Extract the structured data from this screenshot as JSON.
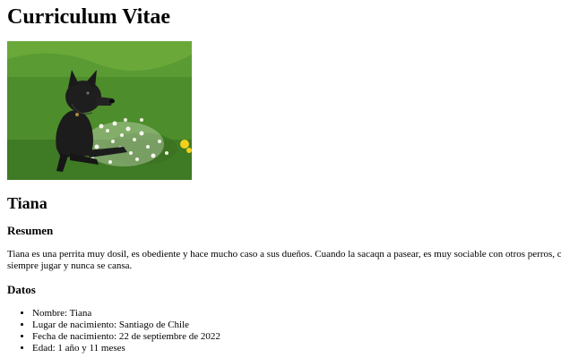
{
  "page": {
    "title": "Curriculum Vitae",
    "name": "Tiana",
    "summary_heading": "Resumen",
    "summary_text": "Tiana es una perrita muy dosil, es obediente y hace mucho caso a sus dueños. Cuando la sacaqn a pasear, es muy sociable con otros perros, c siempre jugar y nunca se cansa.",
    "details_heading": "Datos",
    "details": [
      "Nombre: Tiana",
      "Lugar de nacimiento: Santiago de Chile",
      "Fecha de nacimiento: 22 de septiembre de 2022",
      "Edad: 1 año y 11 meses"
    ]
  },
  "colors": {
    "grass": "#4d8d2c",
    "dog": "#1c1c1c",
    "flowers": "#f4f4ea",
    "dandelion": "#f2cf1d"
  }
}
